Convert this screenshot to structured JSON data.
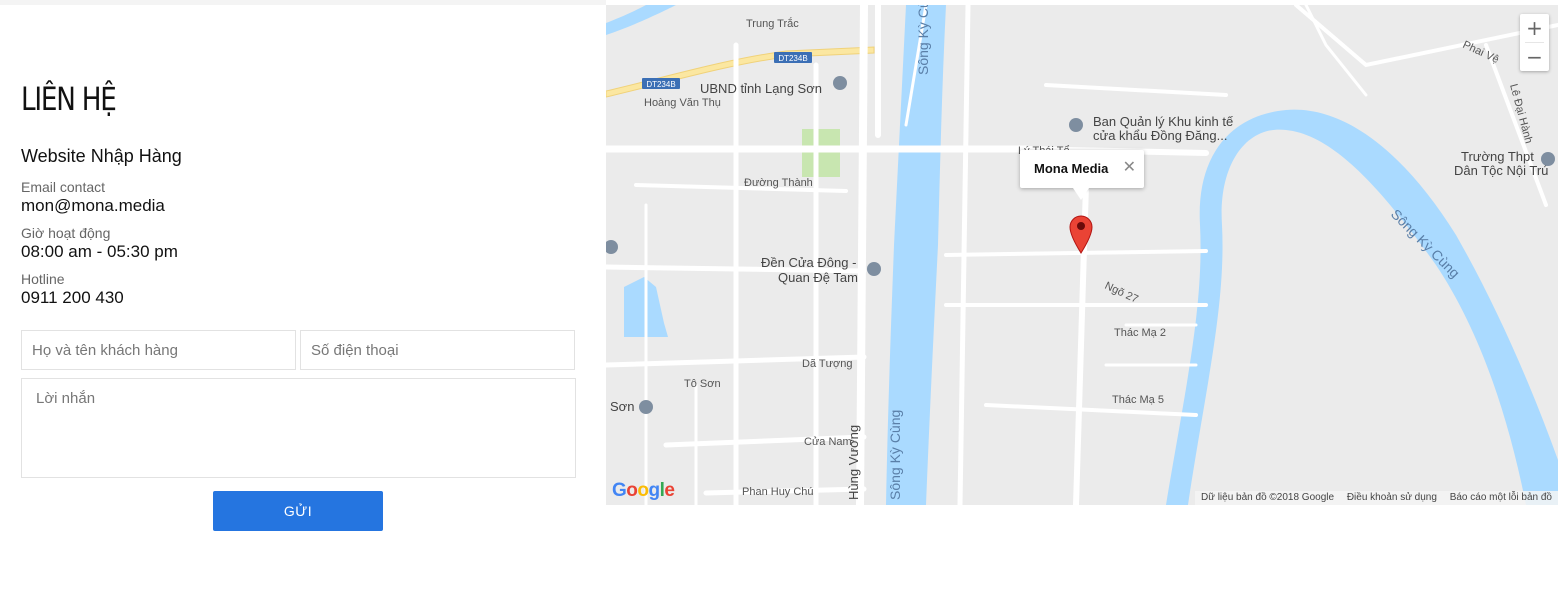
{
  "contact": {
    "title": "LIÊN HỆ",
    "brand": "Website Nhập Hàng",
    "email_label": "Email contact",
    "email_value": "mon@mona.media",
    "hours_label": "Giờ hoạt động",
    "hours_value": "08:00 am - 05:30 pm",
    "hotline_label": "Hotline",
    "hotline_value": "0911 200 430"
  },
  "form": {
    "name_placeholder": "Họ và tên khách hàng",
    "phone_placeholder": "Số điện thoại",
    "message_placeholder": "Lời nhắn",
    "submit_label": "GỬI"
  },
  "map": {
    "zoom_in": "+",
    "zoom_out": "−",
    "infowindow_title": "Mona Media",
    "infowindow_close": "✕",
    "logo": "Google",
    "attribution_data": "Dữ liệu bản đồ ©2018 Google",
    "attribution_terms": "Điều khoản sử dụng",
    "attribution_report": "Báo cáo một lỗi bản đồ",
    "labels": {
      "trung_trac": "Trung Trắc",
      "dt234b_1": "DT234B",
      "dt234b_2": "DT234B",
      "ubnd": "UBND tỉnh Lạng Sơn",
      "hoang_van_thu": "Hoàng Văn Thụ",
      "ban_quan_ly_1": "Ban Quản lý Khu kinh tế",
      "ban_quan_ly_2": "cửa khẩu Đồng Đăng...",
      "ly_thai_to": "Lý Thái Tổ",
      "duong_thanh": "Đường Thành",
      "truong_thpt_1": "Trường Thpt",
      "truong_thpt_2": "Dân Tộc Nội Trú",
      "den_cua_dong_1": "Đền Cửa Đông -",
      "den_cua_dong_2": "Quan Đệ Tam",
      "da_tuong": "Dã Tượng",
      "to_son": "Tô Sơn",
      "cua_nam": "Cửa Nam",
      "phan_huy_chu": "Phan Huy Chú",
      "song_ky_cung": "Sông Kỳ Cùng",
      "hung_vuong": "Hùng Vương",
      "thac_ma_2": "Thác Mạ 2",
      "thac_ma_5": "Thác Mạ 5",
      "ngo_27": "Ngõ 27",
      "phai_ve": "Phai Vệ",
      "le_dai_hanh": "Lê Đại Hành",
      "son": "Sơn"
    }
  },
  "colors": {
    "accent": "#2575e0",
    "river": "#aadaff",
    "map_bg": "#ebebeb",
    "marker": "#ea4335"
  }
}
